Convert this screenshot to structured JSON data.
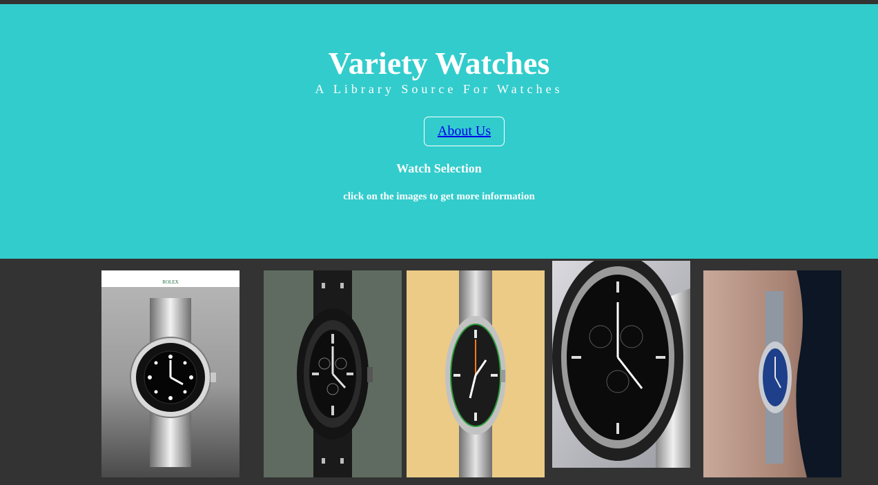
{
  "header": {
    "title": "Variety Watches",
    "subtitle": "A Library Source For Watches",
    "about_link": "About Us",
    "section_heading": "Watch Selection",
    "section_hint": "click on the images to get more information"
  },
  "gallery": {
    "items": [
      {
        "icon": "rolex-submariner-image",
        "brand_mark": "ROLEX"
      },
      {
        "icon": "black-chronograph-image"
      },
      {
        "icon": "milgauss-watch-image"
      },
      {
        "icon": "speedmaster-chronograph-image"
      },
      {
        "icon": "blue-dial-wrist-watch-image"
      }
    ]
  },
  "colors": {
    "header_background": "#33CCCC",
    "page_background": "#333333",
    "link": "#0000EE",
    "text": "#FFFFFF"
  }
}
